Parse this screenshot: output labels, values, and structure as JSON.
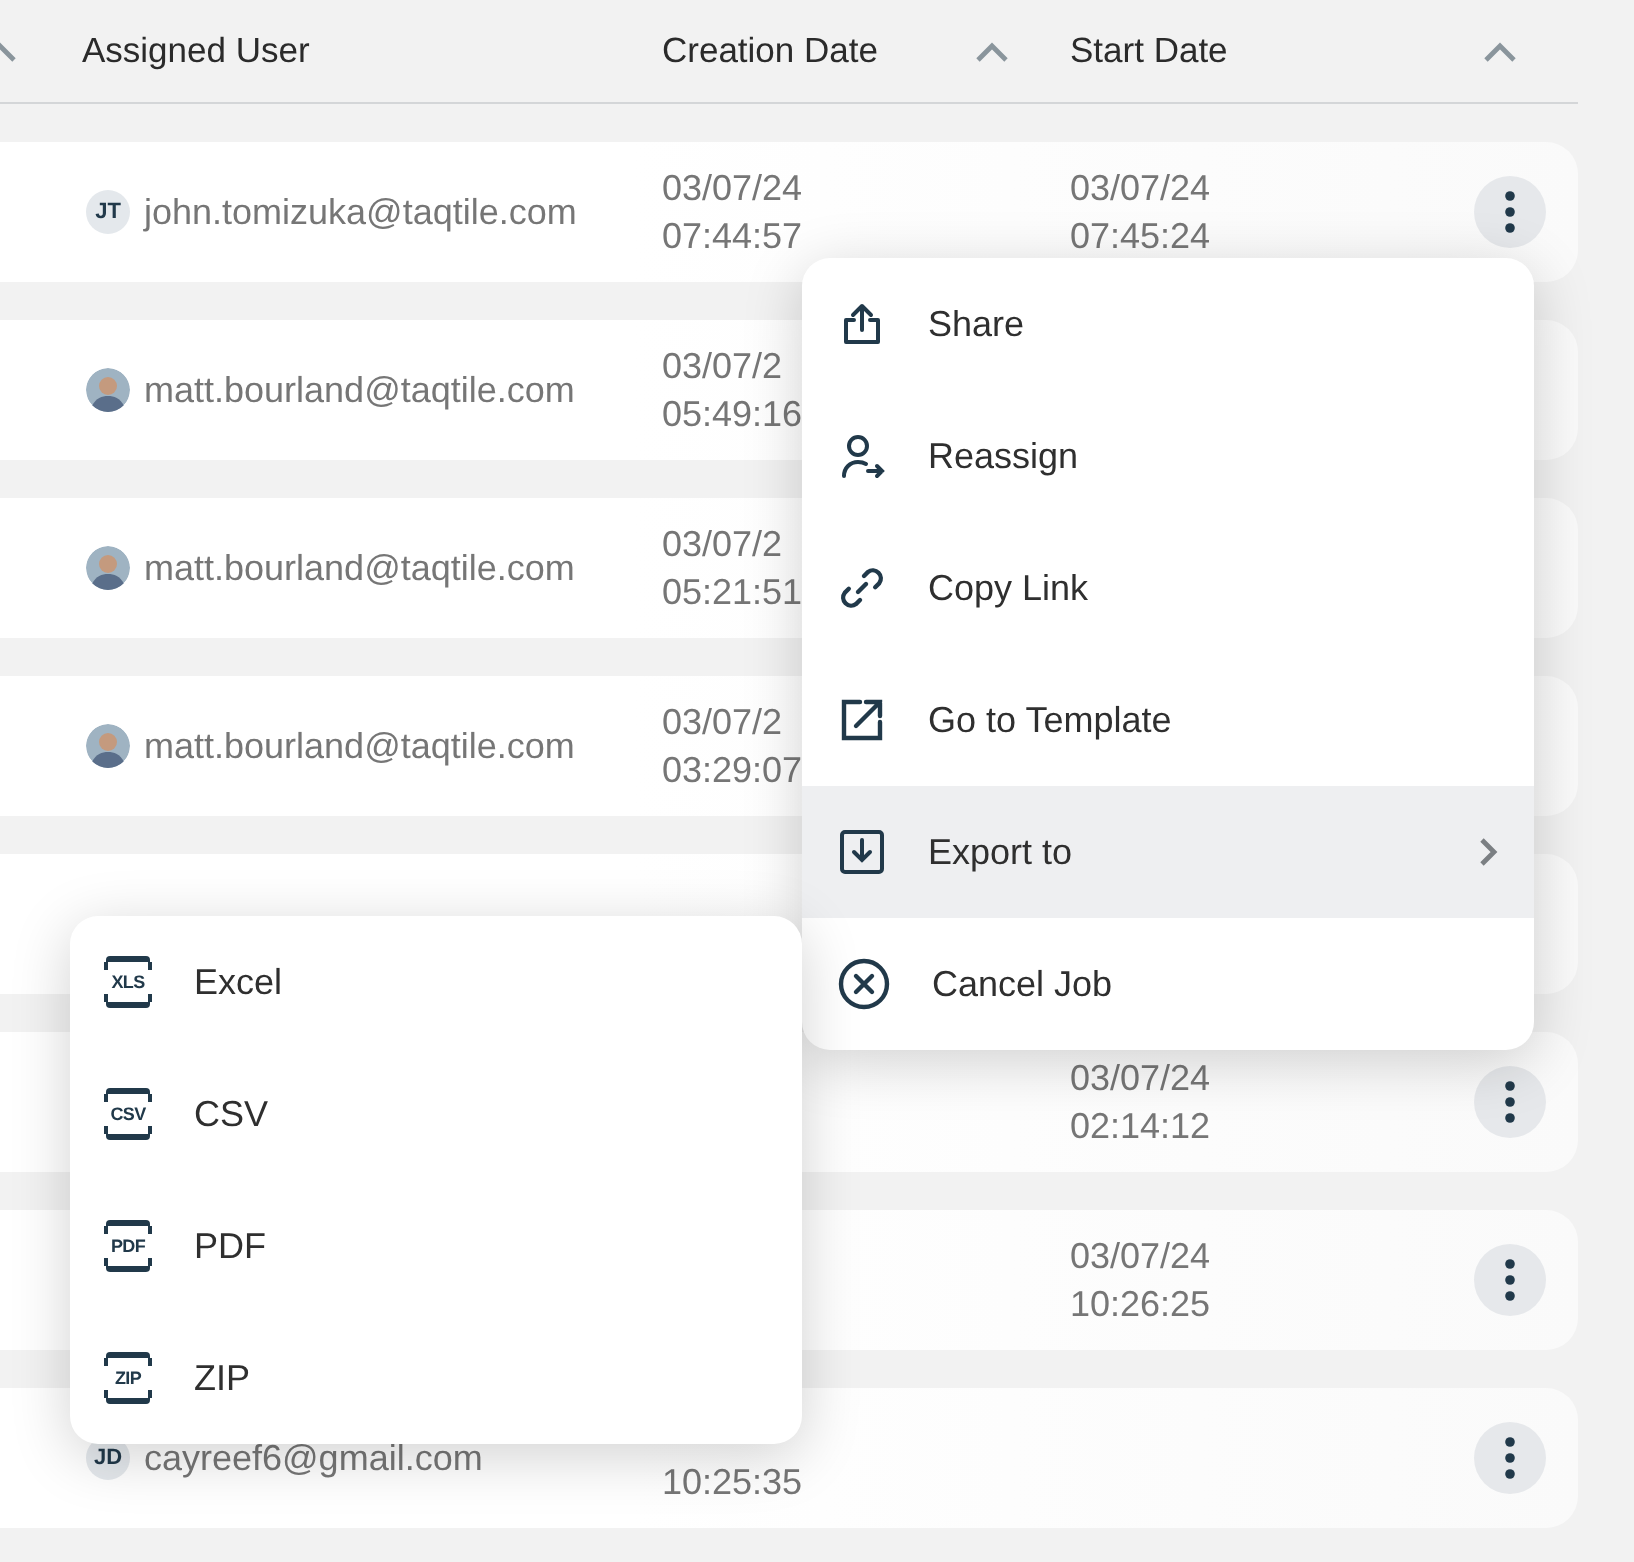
{
  "table": {
    "columns": [
      {
        "label": "Assigned User"
      },
      {
        "label": "Creation Date"
      },
      {
        "label": "Start Date"
      }
    ],
    "rows": [
      {
        "user": {
          "avatar": {
            "kind": "initials",
            "initials": "JT"
          },
          "email": "john.tomizuka@taqtile.com"
        },
        "created": [
          "03/07/24",
          "07:44:57"
        ],
        "started": [
          "03/07/24",
          "07:45:24"
        ],
        "menu_button": true
      },
      {
        "user": {
          "avatar": {
            "kind": "photo"
          },
          "email": "matt.bourland@taqtile.com"
        },
        "created": [
          "03/07/2",
          "05:49:16"
        ],
        "menu_button": false
      },
      {
        "user": {
          "avatar": {
            "kind": "photo"
          },
          "email": "matt.bourland@taqtile.com"
        },
        "created": [
          "03/07/2",
          "05:21:51"
        ],
        "menu_button": false
      },
      {
        "user": {
          "avatar": {
            "kind": "photo"
          },
          "email": "matt.bourland@taqtile.com"
        },
        "created": [
          "03/07/2",
          "03:29:07"
        ],
        "menu_button": false
      },
      {
        "menu_button": false
      },
      {
        "started": [
          "03/07/24",
          "02:14:12"
        ],
        "menu_button": true
      },
      {
        "started": [
          "03/07/24",
          "10:26:25"
        ],
        "menu_button": true
      },
      {
        "user": {
          "avatar": {
            "kind": "initials",
            "initials": "JD"
          },
          "email": "cayreef6@gmail.com"
        },
        "created_time": "10:25:35",
        "menu_button": true
      }
    ]
  },
  "context_menu": {
    "items": [
      {
        "label": "Share",
        "kind": "action",
        "selected": false
      },
      {
        "label": "Reassign",
        "kind": "action",
        "selected": false
      },
      {
        "label": "Copy Link",
        "kind": "action",
        "selected": false
      },
      {
        "label": "Go to Template",
        "kind": "action",
        "selected": false
      },
      {
        "label": "Export to",
        "kind": "submenu",
        "selected": true
      },
      {
        "label": "Cancel Job",
        "kind": "action",
        "selected": false
      }
    ]
  },
  "export_menu": {
    "items": [
      {
        "label": "Excel",
        "icon_label": "XLS"
      },
      {
        "label": "CSV",
        "icon_label": "CSV"
      },
      {
        "label": "PDF",
        "icon_label": "PDF"
      },
      {
        "label": "ZIP",
        "icon_label": "ZIP"
      }
    ]
  }
}
